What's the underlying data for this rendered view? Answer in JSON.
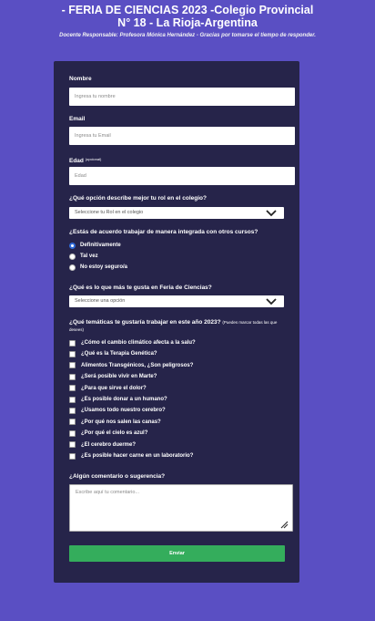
{
  "header": {
    "title_line1": "- FERIA DE CIENCIAS 2023 -Colegio Provincial",
    "title_line2": "N° 18 - La Rioja-Argentina",
    "subtitle": "Docente Responsable: Profesora Mónica Hernández - Gracias por tomarse el tiempo de responder."
  },
  "form": {
    "name": {
      "label": "Nombre",
      "placeholder": "Ingresa tu nombre"
    },
    "email": {
      "label": "Email",
      "placeholder": "Ingresa tu Email"
    },
    "age": {
      "label": "Edad",
      "label_note": "(opcional)",
      "placeholder": "Edad"
    },
    "role": {
      "label": "¿Qué opción describe mejor tu rol en el colegio?",
      "selected": "Seleccione tu Rol en el colegio"
    },
    "integrated": {
      "label": "¿Estás de acuerdo trabajar de manera integrada con otros cursos?",
      "options": [
        "Definitivamente",
        "Tal vez",
        "No estoy seguro/a"
      ],
      "selected_index": 0
    },
    "likes": {
      "label": "¿Qué es lo que más te gusta en Feria de Ciencias?",
      "selected": "Seleccione una opción"
    },
    "topics": {
      "label": "¿Qué temáticas te gustaría trabajar en este año 2023?",
      "note": "(Puedes marcar todas las que desees)",
      "options": [
        "¿Cómo el cambio climático afecta a la salu?",
        "¿Qué es la Terapia Genética?",
        "Alimentos Transgénicos, ¿Son peligrosos?",
        "¿Será posible vivir en Marte?",
        "¿Para que sirve el dolor?",
        "¿Es posible donar a un humano?",
        "¿Usamos todo nuestro cerebro?",
        "¿Por qué nos salen las canas?",
        "¿Por qué el cielo es azul?",
        "¿El cerebro duerme?",
        "¿Es posible hacer carne en un laboratorio?"
      ]
    },
    "comments": {
      "label": "¿Algún comentario o sugerencia?",
      "placeholder": "Escribe aquí tu comentario..."
    },
    "submit_label": "Enviar"
  },
  "colors": {
    "background": "#5a4fc3",
    "panel": "#26244a",
    "submit": "#34ad5c",
    "radio_accent": "#2f6ad8"
  },
  "icons": {
    "select_arrow": "chevron-down-icon",
    "resize_handle": "resize-grip-icon"
  }
}
